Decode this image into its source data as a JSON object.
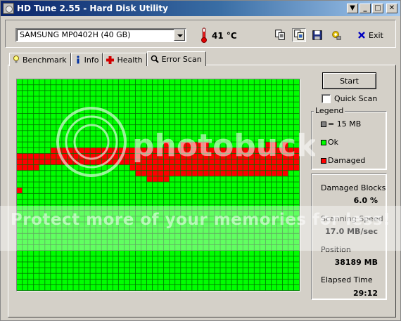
{
  "window": {
    "title": "HD Tune 2.55 - Hard Disk Utility"
  },
  "toolbar": {
    "drive": "SAMSUNG MP0402H (40 GB)",
    "temperature": "41 °C",
    "exit_label": "Exit",
    "icons": [
      "copy-text-icon",
      "copy-screenshot-icon",
      "save-icon",
      "options-icon",
      "exit-icon"
    ]
  },
  "tabs": [
    {
      "label": "Benchmark",
      "icon": "benchmark-icon",
      "active": false
    },
    {
      "label": "Info",
      "icon": "info-icon",
      "active": false
    },
    {
      "label": "Health",
      "icon": "health-icon",
      "active": false
    },
    {
      "label": "Error Scan",
      "icon": "error-scan-icon",
      "active": true
    }
  ],
  "error_scan": {
    "start_label": "Start",
    "quick_scan_label": "Quick Scan",
    "quick_scan_checked": false,
    "legend": {
      "title": "Legend",
      "block_size": "= 15 MB",
      "ok": "Ok",
      "damaged": "Damaged"
    },
    "stats": {
      "damaged_blocks_label": "Damaged Blocks",
      "damaged_blocks_value": "6.0 %",
      "scanning_speed_label": "Scanning Speed",
      "scanning_speed_value": "17.0 MB/sec",
      "position_label": "Position",
      "position_value": "38189 MB",
      "elapsed_time_label": "Elapsed Time",
      "elapsed_time_value": "29:12"
    },
    "colors": {
      "ok": "#00ff00",
      "damaged": "#ff0000",
      "grid": "#007000",
      "unscanned": "#808080"
    },
    "grid": {
      "cols": 50,
      "rows": 37,
      "damaged_rows": [
        [],
        [],
        [],
        [],
        [],
        [],
        [],
        [],
        [],
        [],
        [],
        [],
        [],
        [],
        [],
        [],
        [],
        [],
        [],
        [],
        [],
        [],
        [],
        [],
        [],
        [],
        [],
        [],
        [],
        [],
        [],
        [],
        [],
        [],
        [],
        [],
        []
      ]
    }
  },
  "watermark": {
    "logo_text": "photobucket",
    "band_text": "Protect more of your memories for less!"
  }
}
